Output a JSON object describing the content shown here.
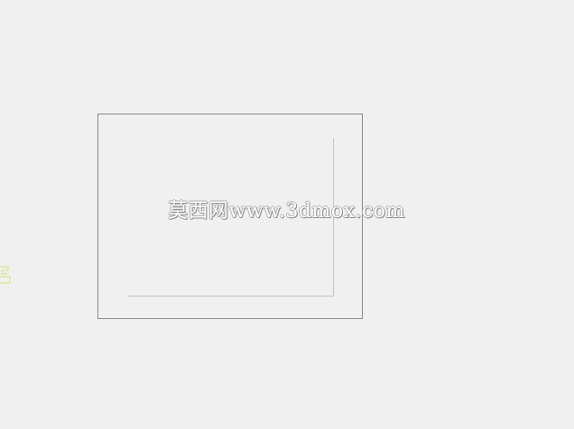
{
  "watermark": {
    "text": "莫西网www.3dmox.com"
  },
  "colors": {
    "background": "#f0f0f0",
    "frame_border": "#8a8a8a",
    "inner_lines": "#c4c4c4",
    "edge_mark": "#d8e07a"
  }
}
